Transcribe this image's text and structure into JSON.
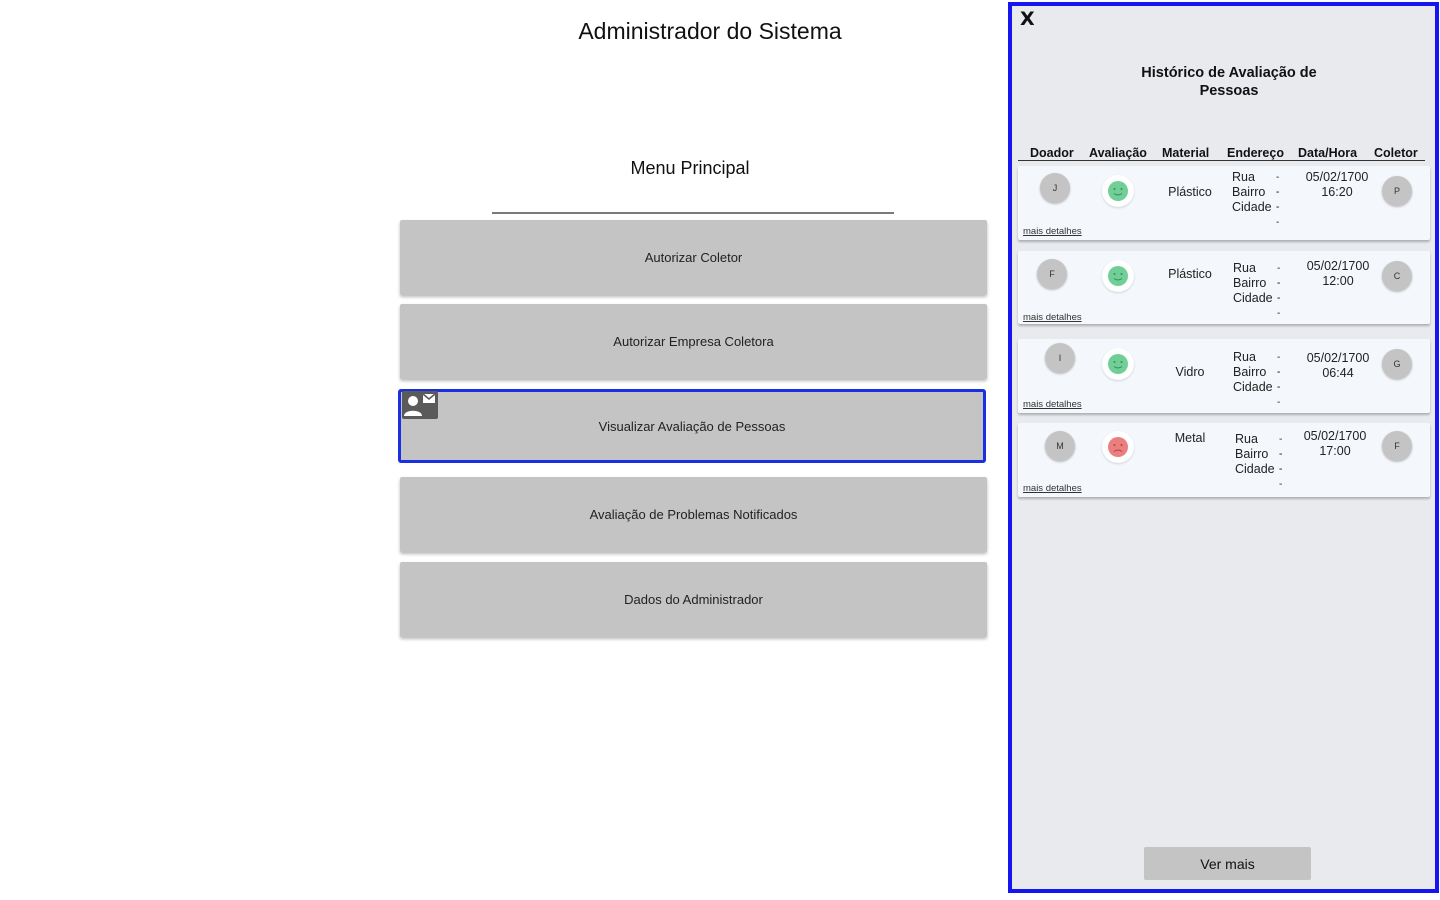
{
  "page": {
    "title": "Administrador do Sistema",
    "menu_title": "Menu Principal"
  },
  "menu": [
    {
      "label": "Autorizar Coletor"
    },
    {
      "label": "Autorizar Empresa Coletora"
    },
    {
      "label": "Visualizar Avaliação de Pessoas",
      "active": true,
      "icon": "contact-mail-icon"
    },
    {
      "label": "Avaliação de Problemas Notificados"
    },
    {
      "label": "Dados do Administrador"
    }
  ],
  "panel": {
    "close_label": "X",
    "title": "Histórico de Avaliação de Pessoas",
    "columns": [
      "Doador",
      "Avaliação",
      "Material",
      "Endereço",
      "Data/Hora",
      "Coletor"
    ],
    "address_labels": [
      "Rua",
      "Bairro",
      "Cidade"
    ],
    "address_value": "--",
    "more_details_label": "mais detalhes",
    "see_more_label": "Ver mais",
    "rows": [
      {
        "donor": "J",
        "rating": "happy",
        "material": "Plástico",
        "date": "05/02/1700",
        "time": "16:20",
        "collector": "P"
      },
      {
        "donor": "F",
        "rating": "happy",
        "material": "Plástico",
        "date": "05/02/1700",
        "time": "12:00",
        "collector": "C"
      },
      {
        "donor": "I",
        "rating": "happy",
        "material": "Vidro",
        "date": "05/02/1700",
        "time": "06:44",
        "collector": "G"
      },
      {
        "donor": "M",
        "rating": "sad",
        "material": "Metal",
        "date": "05/02/1700",
        "time": "17:00",
        "collector": "F"
      }
    ]
  },
  "colors": {
    "accent_border": "#1515f0",
    "button_gray": "#c4c4c4",
    "happy": "#6fcf97",
    "sad": "#eb7f7f"
  }
}
